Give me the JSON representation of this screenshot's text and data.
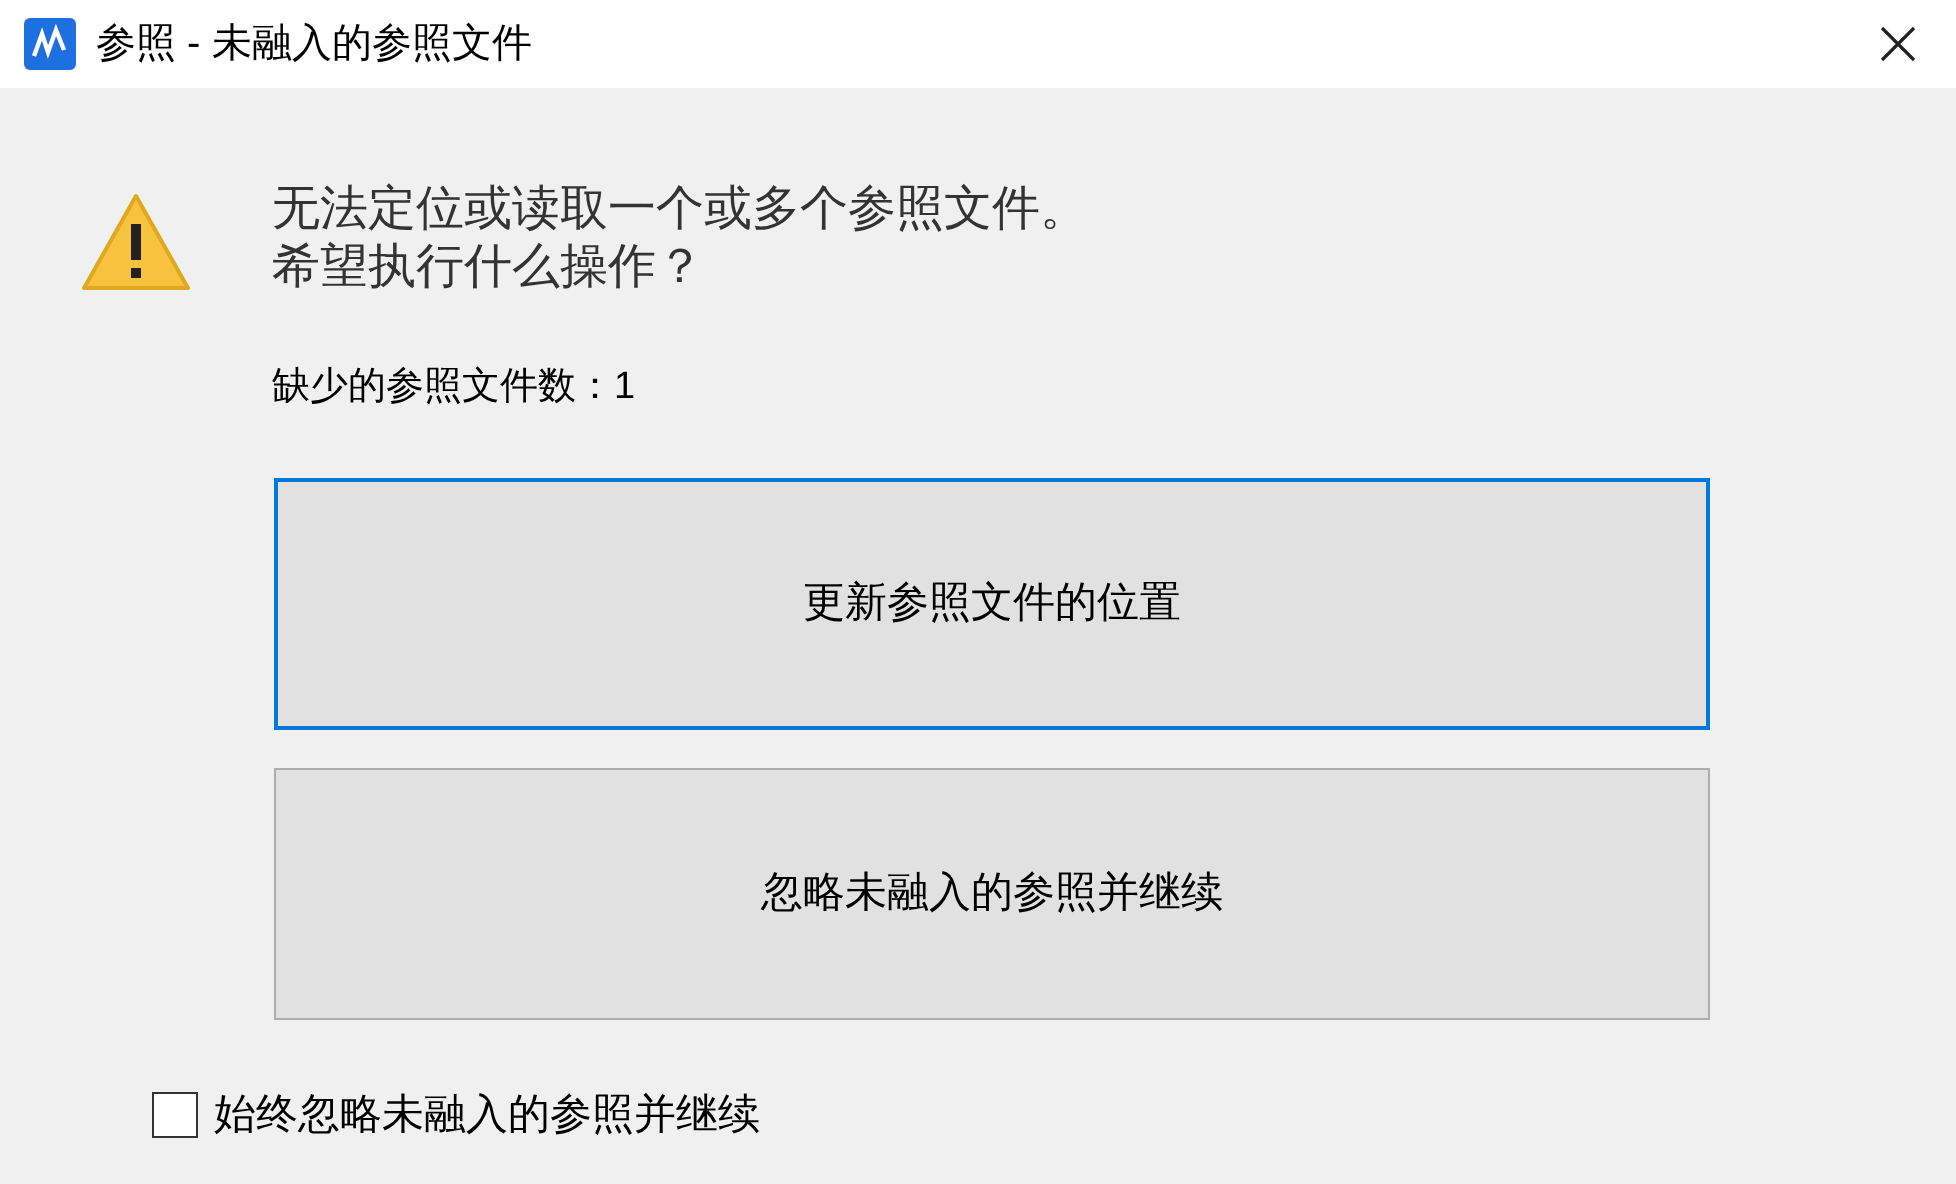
{
  "window": {
    "title": "参照 - 未融入的参照文件"
  },
  "message": {
    "lines": [
      "无法定位或读取一个或多个参照文件。",
      "希望执行什么操作？"
    ]
  },
  "missing_count": "缺少的参照文件数：1",
  "buttons": [
    {
      "label": "更新参照文件的位置",
      "selected": true
    },
    {
      "label": "忽略未融入的参照并继续",
      "selected": false
    }
  ],
  "checkbox": {
    "label": "始终忽略未融入的参照并继续",
    "checked": false
  }
}
